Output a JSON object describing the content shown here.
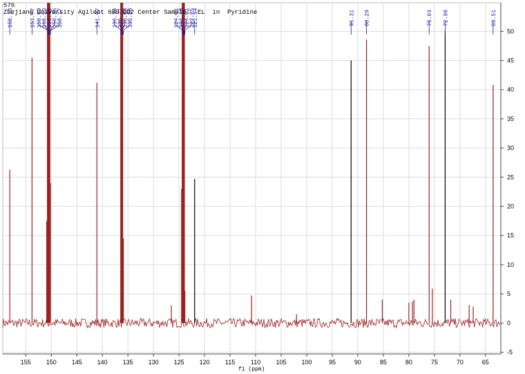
{
  "header": {
    "experiment_number": "576",
    "title": "Zhejiang University Agilent 600 DD2 Center Sample:  EL  in  Pyridine"
  },
  "chart_data": {
    "type": "line",
    "title": "",
    "xlabel": "f1 (ppm)",
    "ylabel": "",
    "xlim": [
      159.5,
      62.0
    ],
    "ylim": [
      -5.3,
      54.9
    ],
    "x_reversed": true,
    "grid": true,
    "x_ticks": [
      155,
      150,
      145,
      140,
      135,
      130,
      125,
      120,
      115,
      110,
      105,
      100,
      95,
      90,
      85,
      80,
      75,
      70,
      65
    ],
    "y_ticks": [
      -5,
      0,
      5,
      10,
      15,
      20,
      25,
      30,
      35,
      40,
      45,
      50
    ],
    "y_axis_side": "right",
    "line_color": "#9b2020",
    "peak_labels": [
      "158.13",
      "153.77",
      "150.69",
      "150.53",
      "150.40",
      "150.35",
      "150.17",
      "141.07",
      "136.34",
      "136.21",
      "136.08",
      "135.88",
      "124.31",
      "124.18",
      "124.01",
      "123.85",
      "121.94",
      "91.31",
      "88.29",
      "76.03",
      "72.90",
      "63.51"
    ],
    "peaks": [
      {
        "ppm": 158.13,
        "height": 26.3
      },
      {
        "ppm": 153.77,
        "height": 45.5
      },
      {
        "ppm": 150.9,
        "height": 17.5
      },
      {
        "ppm": 150.69,
        "height": 60
      },
      {
        "ppm": 150.53,
        "height": 60
      },
      {
        "ppm": 150.4,
        "height": 60
      },
      {
        "ppm": 150.35,
        "height": 60
      },
      {
        "ppm": 150.17,
        "height": 24
      },
      {
        "ppm": 141.07,
        "height": 41.2
      },
      {
        "ppm": 136.34,
        "height": 60
      },
      {
        "ppm": 136.21,
        "height": 60
      },
      {
        "ppm": 136.08,
        "height": 60
      },
      {
        "ppm": 135.88,
        "height": 14.5
      },
      {
        "ppm": 126.5,
        "height": 3
      },
      {
        "ppm": 124.5,
        "height": 23
      },
      {
        "ppm": 124.31,
        "height": 60
      },
      {
        "ppm": 124.18,
        "height": 60
      },
      {
        "ppm": 124.01,
        "height": 60
      },
      {
        "ppm": 123.85,
        "height": 5.5
      },
      {
        "ppm": 121.94,
        "height": 24.7,
        "color": "#000000"
      },
      {
        "ppm": 110.8,
        "height": 4.7
      },
      {
        "ppm": 102.0,
        "height": 1.5
      },
      {
        "ppm": 91.31,
        "height": 45,
        "color": "#000000"
      },
      {
        "ppm": 88.29,
        "height": 48.6
      },
      {
        "ppm": 85.2,
        "height": 4
      },
      {
        "ppm": 80.0,
        "height": 3.5
      },
      {
        "ppm": 79.3,
        "height": 3.7
      },
      {
        "ppm": 79.0,
        "height": 4
      },
      {
        "ppm": 76.03,
        "height": 47.5
      },
      {
        "ppm": 75.4,
        "height": 5.9
      },
      {
        "ppm": 72.9,
        "height": 50,
        "color": "#000000"
      },
      {
        "ppm": 71.8,
        "height": 4
      },
      {
        "ppm": 68.2,
        "height": 3.1
      },
      {
        "ppm": 67.4,
        "height": 2.8
      },
      {
        "ppm": 63.51,
        "height": 40.8
      }
    ]
  }
}
